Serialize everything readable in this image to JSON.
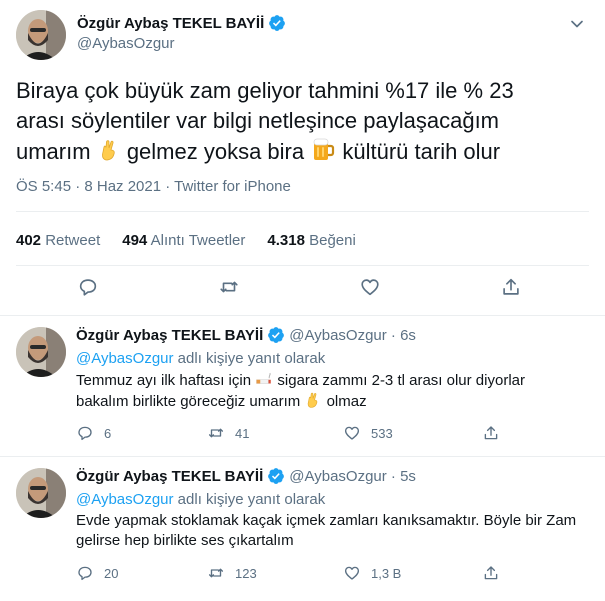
{
  "main_tweet": {
    "author_name": "Özgür Aybaş TEKEL BAYİİ",
    "author_handle": "@AybasOzgur",
    "text_line1": "Biraya çok büyük zam geliyor tahmini %17 ile % 23",
    "text_line2": "arası söylentiler var bilgi netleşince paylaşacağım",
    "text_line3_a": "umarım",
    "text_line3_b": "gelmez yoksa bira",
    "text_line3_c": "kültürü tarih olur",
    "meta": "ÖS 5:45 · 8 Haz 2021 · Twitter for iPhone",
    "retweets_count": "402",
    "retweets_label": "Retweet",
    "quotes_count": "494",
    "quotes_label": "Alıntı Tweetler",
    "likes_count": "4.318",
    "likes_label": "Beğeni"
  },
  "replies": [
    {
      "author_name": "Özgür Aybaş TEKEL BAYİİ",
      "handle_time": "@AybasOzgur · 6s",
      "reply_to_handle": "@AybasOzgur",
      "reply_to_label": "adlı kişiye yanıt olarak",
      "text_line1_a": "Temmuz ayı ilk haftası için",
      "text_line1_b": "sigara zammı  2-3 tl arası olur diyorlar",
      "text_line2_a": "bakalım birlikte göreceğiz umarım",
      "text_line2_b": "olmaz",
      "reply_count": "6",
      "retweet_count": "41",
      "like_count": "533"
    },
    {
      "author_name": "Özgür Aybaş TEKEL BAYİİ",
      "handle_time": "@AybasOzgur · 5s",
      "reply_to_handle": "@AybasOzgur",
      "reply_to_label": "adlı kişiye yanıt olarak",
      "text_line1": "Evde yapmak stoklamak kaçak içmek zamları kanıksamaktır. Böyle bir Zam",
      "text_line2": "gelirse hep birlikte ses çıkartalım",
      "reply_count": "20",
      "retweet_count": "123",
      "like_count": "1,3 B"
    }
  ],
  "icons": {
    "verified": "verified-badge-icon",
    "caret": "chevron-down-icon",
    "reply": "reply-icon",
    "retweet": "retweet-icon",
    "like": "heart-icon",
    "share": "share-icon"
  },
  "colors": {
    "text": "#0f1419",
    "secondary": "#5b7083",
    "link": "#1da1f2",
    "verified": "#1da1f2",
    "divider": "#ebeef0"
  }
}
